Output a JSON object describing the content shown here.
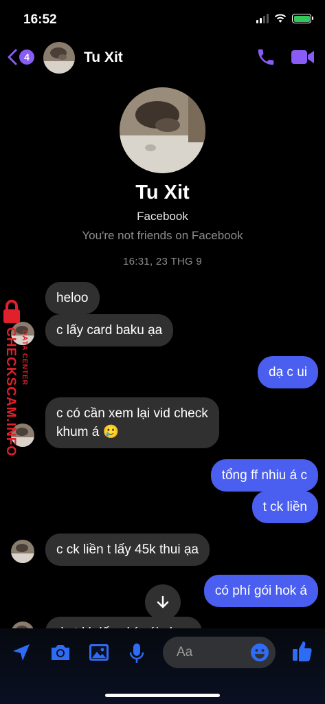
{
  "status_bar": {
    "time": "16:52"
  },
  "header": {
    "back_count": "4",
    "contact_name": "Tu Xit"
  },
  "profile": {
    "name": "Tu Xit",
    "platform": "Facebook",
    "relationship": "You're not friends on Facebook"
  },
  "conversation": {
    "timestamp": "16:31, 23 THG 9",
    "messages": [
      {
        "side": "in",
        "text": "heloo"
      },
      {
        "side": "in",
        "text": "c lấy card baku ạa"
      },
      {
        "side": "out",
        "text": "dạ c ui"
      },
      {
        "side": "in",
        "line1": "c có cần xem lại vid check",
        "line2": "khum á 🥲"
      },
      {
        "side": "out",
        "text": "tổng ff nhiu á c"
      },
      {
        "side": "out",
        "text": "t ck liền"
      },
      {
        "side": "in",
        "text": "c ck liền t lấy 45k thui ạa"
      },
      {
        "side": "out",
        "text": "có phí gói hok á"
      },
      {
        "side": "in",
        "text": "dạ t kh lấy phí gói nhoa"
      }
    ]
  },
  "watermark": {
    "main": "CHECKSCAM.INFO",
    "sub": "DATA CENTER"
  },
  "composer": {
    "placeholder": "Aa"
  },
  "icons": [
    "back-chevron-icon",
    "phone-icon",
    "video-camera-icon",
    "arrow-down-icon",
    "send-location-icon",
    "camera-icon",
    "image-icon",
    "microphone-icon",
    "emoji-icon",
    "thumbs-up-icon",
    "lock-icon"
  ],
  "colors": {
    "accent": "#8a5cf6",
    "outgoing_bubble": "#4a5ff0",
    "incoming_bubble": "#303030",
    "composer_icon": "#2f6cf5",
    "watermark": "#e0202a"
  }
}
